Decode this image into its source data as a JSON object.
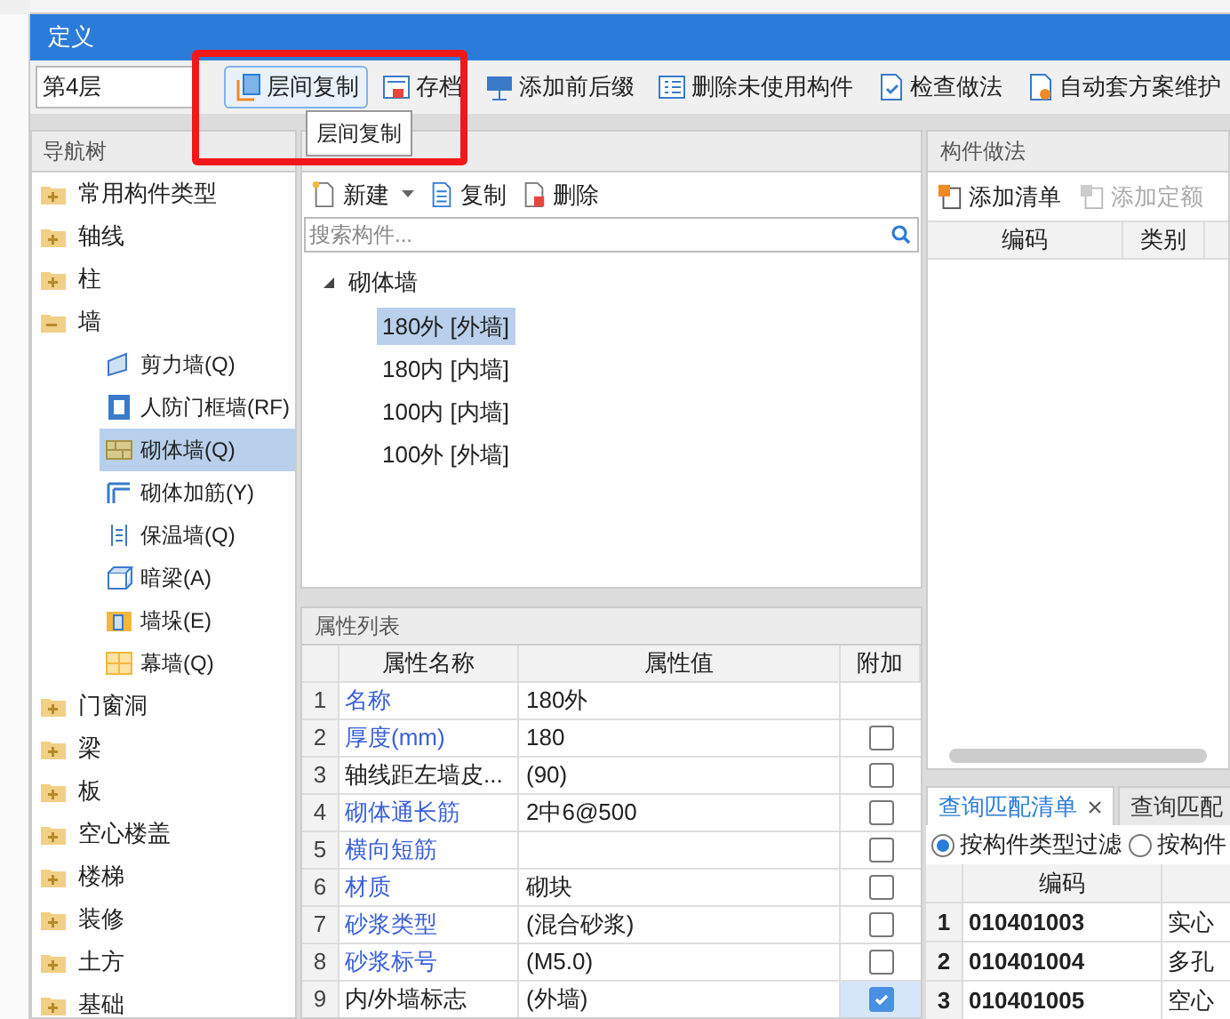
{
  "dialog": {
    "title": "定义"
  },
  "toolbar": {
    "floor": "第4层",
    "buttons": [
      {
        "label": "层间复制",
        "selected": true
      },
      {
        "label": "存档",
        "selected": false
      },
      {
        "label": "添加前后缀",
        "selected": false
      },
      {
        "label": "删除未使用构件",
        "selected": false
      },
      {
        "label": "检查做法",
        "selected": false
      },
      {
        "label": "自动套方案维护",
        "selected": false
      }
    ]
  },
  "tooltip": "层间复制",
  "nav": {
    "title": "导航树",
    "items": [
      {
        "label": "常用构件类型",
        "expanded": false
      },
      {
        "label": "轴线",
        "expanded": false
      },
      {
        "label": "柱",
        "expanded": false
      },
      {
        "label": "墙",
        "expanded": true,
        "children": [
          {
            "label": "剪力墙(Q)",
            "selected": false
          },
          {
            "label": "人防门框墙(RF)",
            "selected": false
          },
          {
            "label": "砌体墙(Q)",
            "selected": true
          },
          {
            "label": "砌体加筋(Y)",
            "selected": false
          },
          {
            "label": "保温墙(Q)",
            "selected": false
          },
          {
            "label": "暗梁(A)",
            "selected": false
          },
          {
            "label": "墙垛(E)",
            "selected": false
          },
          {
            "label": "幕墙(Q)",
            "selected": false
          }
        ]
      },
      {
        "label": "门窗洞",
        "expanded": false
      },
      {
        "label": "梁",
        "expanded": false
      },
      {
        "label": "板",
        "expanded": false
      },
      {
        "label": "空心楼盖",
        "expanded": false
      },
      {
        "label": "楼梯",
        "expanded": false
      },
      {
        "label": "装修",
        "expanded": false
      },
      {
        "label": "土方",
        "expanded": false
      },
      {
        "label": "基础",
        "expanded": false
      }
    ]
  },
  "components": {
    "toolbar": [
      "新建",
      "复制",
      "删除"
    ],
    "search": {
      "placeholder": "搜索构件..."
    },
    "group": "砌体墙",
    "expanded": true,
    "items": [
      {
        "label": "180外 [外墙]",
        "selected": true
      },
      {
        "label": "180内 [内墙]",
        "selected": false
      },
      {
        "label": "100内 [内墙]",
        "selected": false
      },
      {
        "label": "100外 [外墙]",
        "selected": false
      }
    ]
  },
  "properties": {
    "title": "属性列表",
    "columns": [
      "属性名称",
      "属性值",
      "附加"
    ],
    "rows": [
      {
        "index": "1",
        "name": "名称",
        "value": "180外",
        "public": true
      },
      {
        "index": "2",
        "name": "厚度(mm)",
        "value": "180",
        "public": true,
        "checked": false
      },
      {
        "index": "3",
        "name": "轴线距左墙皮...",
        "value": "(90)",
        "public": false,
        "checked": false
      },
      {
        "index": "4",
        "name": "砌体通长筋",
        "value": "2中6@500",
        "public": true,
        "checked": false
      },
      {
        "index": "5",
        "name": "横向短筋",
        "value": "",
        "public": true,
        "checked": false
      },
      {
        "index": "6",
        "name": "材质",
        "value": "砌块",
        "public": true,
        "checked": false
      },
      {
        "index": "7",
        "name": "砂浆类型",
        "value": "(混合砂浆)",
        "public": true,
        "checked": false
      },
      {
        "index": "8",
        "name": "砂浆标号",
        "value": "(M5.0)",
        "public": true,
        "checked": false
      },
      {
        "index": "9",
        "name": "内/外墙标志",
        "value": "(外墙)",
        "public": false,
        "checked": true
      }
    ]
  },
  "method": {
    "title": "构件做法",
    "toolbar": [
      {
        "label": "添加清单",
        "disabled": false
      },
      {
        "label": "添加定额",
        "disabled": true
      }
    ],
    "columns": [
      "编码",
      "类别"
    ]
  },
  "query": {
    "tabs": [
      {
        "label": "查询匹配清单",
        "selected": true
      },
      {
        "label": "查询匹配",
        "selected": false
      }
    ],
    "filters": [
      {
        "label": "按构件类型过滤",
        "selected": true
      },
      {
        "label": "按构件",
        "selected": false
      }
    ],
    "columns": [
      "编码"
    ],
    "rows": [
      {
        "index": "1",
        "code": "010401003",
        "name": "实心"
      },
      {
        "index": "2",
        "code": "010401004",
        "name": "多孔"
      },
      {
        "index": "3",
        "code": "010401005",
        "name": "空心"
      }
    ]
  }
}
